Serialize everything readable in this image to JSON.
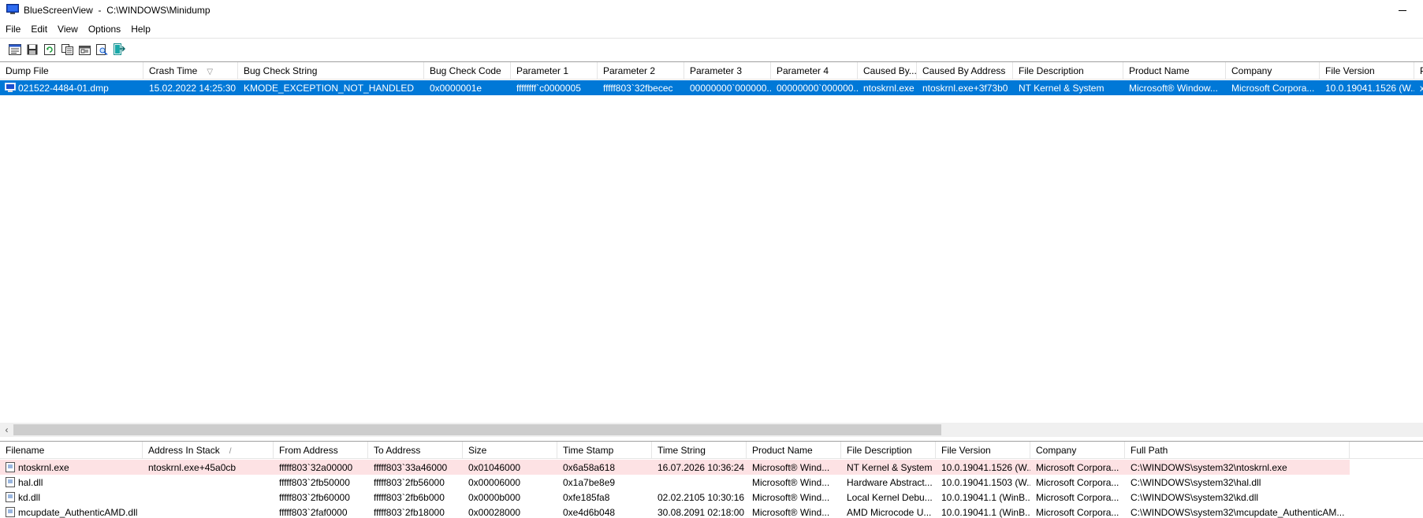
{
  "window": {
    "app_name": "BlueScreenView",
    "title_sep": "-",
    "path": "C:\\WINDOWS\\Minidump"
  },
  "menu": [
    "File",
    "Edit",
    "View",
    "Options",
    "Help"
  ],
  "toolbar": {
    "buttons": [
      "html-report-icon",
      "save-icon",
      "refresh-icon",
      "copy-icon",
      "properties-icon",
      "search-icon",
      "exit-icon"
    ]
  },
  "upper": {
    "columns": [
      "Dump File",
      "Crash Time",
      "Bug Check String",
      "Bug Check Code",
      "Parameter 1",
      "Parameter 2",
      "Parameter 3",
      "Parameter 4",
      "Caused By...",
      "Caused By Address",
      "File Description",
      "Product Name",
      "Company",
      "File Version",
      "P"
    ],
    "sort_indicator": "▽",
    "rows": [
      [
        "021522-4484-01.dmp",
        "15.02.2022 14:25:30",
        "KMODE_EXCEPTION_NOT_HANDLED",
        "0x0000001e",
        "ffffffff`c0000005",
        "fffff803`32fbecec",
        "00000000`000000...",
        "00000000`000000...",
        "ntoskrnl.exe",
        "ntoskrnl.exe+3f73b0",
        "NT Kernel & System",
        "Microsoft® Window...",
        "Microsoft Corpora...",
        "10.0.19041.1526 (W...",
        "x"
      ]
    ]
  },
  "lower": {
    "columns": [
      "Filename",
      "Address In Stack",
      "From Address",
      "To Address",
      "Size",
      "Time Stamp",
      "Time String",
      "Product Name",
      "File Description",
      "File Version",
      "Company",
      "Full Path"
    ],
    "sort_indicator": "/",
    "rows": [
      [
        "ntoskrnl.exe",
        "ntoskrnl.exe+45a0cb",
        "fffff803`32a00000",
        "fffff803`33a46000",
        "0x01046000",
        "0x6a58a618",
        "16.07.2026 10:36:24",
        "Microsoft® Wind...",
        "NT Kernel & System",
        "10.0.19041.1526 (W...",
        "Microsoft Corpora...",
        "C:\\WINDOWS\\system32\\ntoskrnl.exe"
      ],
      [
        "hal.dll",
        "",
        "fffff803`2fb50000",
        "fffff803`2fb56000",
        "0x00006000",
        "0x1a7be8e9",
        "",
        "Microsoft® Wind...",
        "Hardware Abstract...",
        "10.0.19041.1503 (W...",
        "Microsoft Corpora...",
        "C:\\WINDOWS\\system32\\hal.dll"
      ],
      [
        "kd.dll",
        "",
        "fffff803`2fb60000",
        "fffff803`2fb6b000",
        "0x0000b000",
        "0xfe185fa8",
        "02.02.2105 10:30:16",
        "Microsoft® Wind...",
        "Local Kernel Debu...",
        "10.0.19041.1 (WinB...",
        "Microsoft Corpora...",
        "C:\\WINDOWS\\system32\\kd.dll"
      ],
      [
        "mcupdate_AuthenticAMD.dll",
        "",
        "fffff803`2faf0000",
        "fffff803`2fb18000",
        "0x00028000",
        "0xe4d6b048",
        "30.08.2091 02:18:00",
        "Microsoft® Wind...",
        "AMD Microcode U...",
        "10.0.19041.1 (WinB...",
        "Microsoft Corpora...",
        "C:\\WINDOWS\\system32\\mcupdate_AuthenticAM..."
      ]
    ]
  },
  "colors": {
    "selection": "#0078d7",
    "highlight_row": "#fde2e4"
  }
}
